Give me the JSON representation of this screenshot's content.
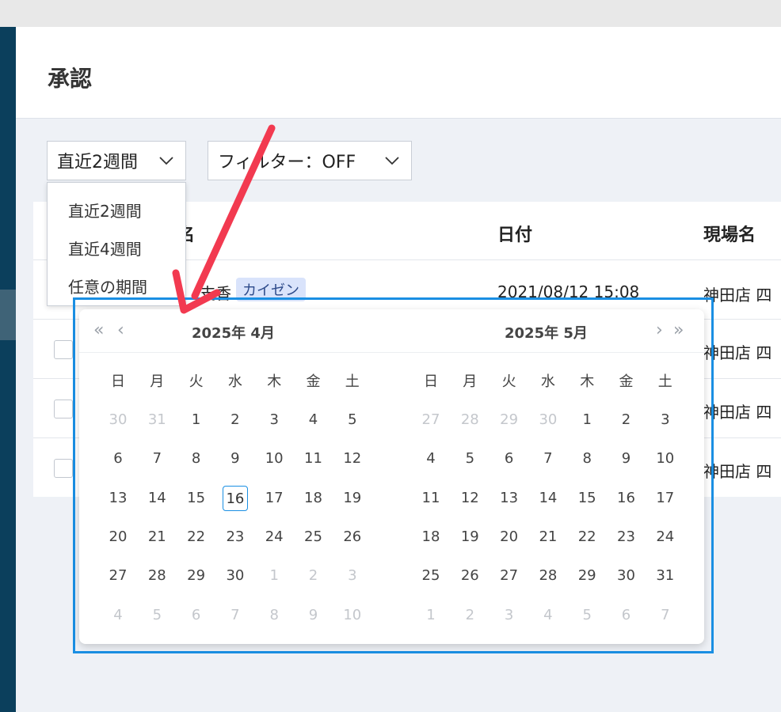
{
  "page": {
    "title": "承認"
  },
  "toolbar": {
    "range_label": "直近2週間",
    "filter_label": "フィルター：OFF"
  },
  "dropdown": {
    "items": [
      "直近2週間",
      "直近4週間",
      "任意の期間"
    ]
  },
  "table": {
    "headers": {
      "name": "名",
      "date": "日付",
      "site": "現場名"
    },
    "rows": [
      {
        "name_partial": "支香",
        "tag": "カイゼン",
        "date": "2021/08/12 15:08",
        "site": "神田店 四"
      },
      {
        "site": "神田店 四"
      },
      {
        "site": "神田店 四"
      },
      {
        "site": "神田店 四"
      }
    ]
  },
  "datepicker": {
    "nav": {
      "prev_year": "«",
      "prev_month": "‹",
      "next_month": "›",
      "next_year": "»"
    },
    "weekdays": [
      "日",
      "月",
      "火",
      "水",
      "木",
      "金",
      "土"
    ],
    "left": {
      "title": "2025年  4月",
      "weeks": [
        [
          "30",
          "31",
          "1",
          "2",
          "3",
          "4",
          "5"
        ],
        [
          "6",
          "7",
          "8",
          "9",
          "10",
          "11",
          "12"
        ],
        [
          "13",
          "14",
          "15",
          "16",
          "17",
          "18",
          "19"
        ],
        [
          "20",
          "21",
          "22",
          "23",
          "24",
          "25",
          "26"
        ],
        [
          "27",
          "28",
          "29",
          "30",
          "1",
          "2",
          "3"
        ],
        [
          "4",
          "5",
          "6",
          "7",
          "8",
          "9",
          "10"
        ]
      ],
      "muted": [
        [
          0,
          0
        ],
        [
          0,
          1
        ],
        [
          4,
          4
        ],
        [
          4,
          5
        ],
        [
          4,
          6
        ],
        [
          5,
          0
        ],
        [
          5,
          1
        ],
        [
          5,
          2
        ],
        [
          5,
          3
        ],
        [
          5,
          4
        ],
        [
          5,
          5
        ],
        [
          5,
          6
        ]
      ],
      "today": [
        2,
        3
      ]
    },
    "right": {
      "title": "2025年  5月",
      "weeks": [
        [
          "27",
          "28",
          "29",
          "30",
          "1",
          "2",
          "3"
        ],
        [
          "4",
          "5",
          "6",
          "7",
          "8",
          "9",
          "10"
        ],
        [
          "11",
          "12",
          "13",
          "14",
          "15",
          "16",
          "17"
        ],
        [
          "18",
          "19",
          "20",
          "21",
          "22",
          "23",
          "24"
        ],
        [
          "25",
          "26",
          "27",
          "28",
          "29",
          "30",
          "31"
        ],
        [
          "1",
          "2",
          "3",
          "4",
          "5",
          "6",
          "7"
        ]
      ],
      "muted": [
        [
          0,
          0
        ],
        [
          0,
          1
        ],
        [
          0,
          2
        ],
        [
          0,
          3
        ],
        [
          5,
          0
        ],
        [
          5,
          1
        ],
        [
          5,
          2
        ],
        [
          5,
          3
        ],
        [
          5,
          4
        ],
        [
          5,
          5
        ],
        [
          5,
          6
        ]
      ]
    }
  },
  "colors": {
    "accent": "#1a8fe3",
    "arrow": "#f23a50",
    "nav": "#0b3f5c"
  }
}
